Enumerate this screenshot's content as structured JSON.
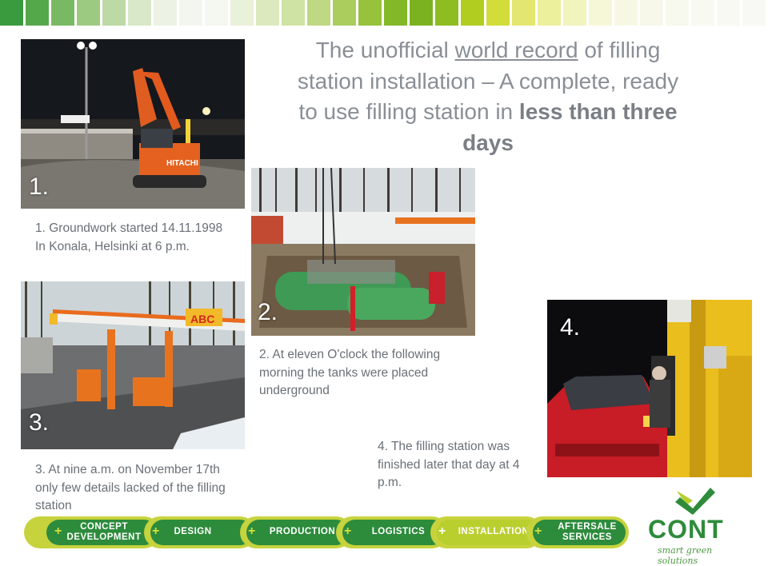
{
  "colors": {
    "top_squares": [
      "#3a9a3e",
      "#55a849",
      "#79b963",
      "#9cca80",
      "#bdd9a5",
      "#d8e8c8",
      "#ecf3e4",
      "#f3f6ef",
      "#f5f7f1",
      "#eaf1d9",
      "#dce9bf",
      "#cfe3a4",
      "#bfd884",
      "#aacd5e",
      "#97c23c",
      "#83b829",
      "#7bb320",
      "#8dbd21",
      "#b1cd20",
      "#d3dd39",
      "#e3e66f",
      "#ecef9c",
      "#f2f4bd",
      "#f6f7d6",
      "#f7f8e4",
      "#f7f8ea",
      "#f7f8ee",
      "#f8f9f1",
      "#f8f9f3",
      "#f8f9f4"
    ],
    "brand_green": "#2e8b3a",
    "brand_lime": "#c7d33c"
  },
  "title": {
    "part1": "The unofficial ",
    "underlined": "world record",
    "part2": " of filling station installation – A complete, ready to use filling station in ",
    "bold": "less than three days"
  },
  "photos": [
    {
      "number": "1.",
      "caption": "1. Groundwork started 14.11.1998 In Konala, Helsinki at 6 p.m."
    },
    {
      "number": "2.",
      "caption": "2. At eleven O'clock the following morning the tanks were placed underground"
    },
    {
      "number": "3.",
      "caption": "3. At nine a.m. on November 17th only few details  lacked of the filling station"
    },
    {
      "number": "4.",
      "caption": "4. The filling station was finished later that day at 4 p.m."
    }
  ],
  "scene": {
    "excavator_brand": "HITACHI",
    "sign_abc": "ABC"
  },
  "nav": [
    {
      "line1": "CONCEPT",
      "line2": "DEVELOPMENT"
    },
    {
      "line1": "DESIGN",
      "line2": ""
    },
    {
      "line1": "PRODUCTION",
      "line2": ""
    },
    {
      "line1": "LOGISTICS",
      "line2": ""
    },
    {
      "line1": "INSTALLATION",
      "line2": "",
      "active": true
    },
    {
      "line1": "AFTERSALE",
      "line2": "SERVICES"
    }
  ],
  "nav_plus": "+",
  "logo": {
    "word": "CONT",
    "tagline": "smart green solutions"
  }
}
